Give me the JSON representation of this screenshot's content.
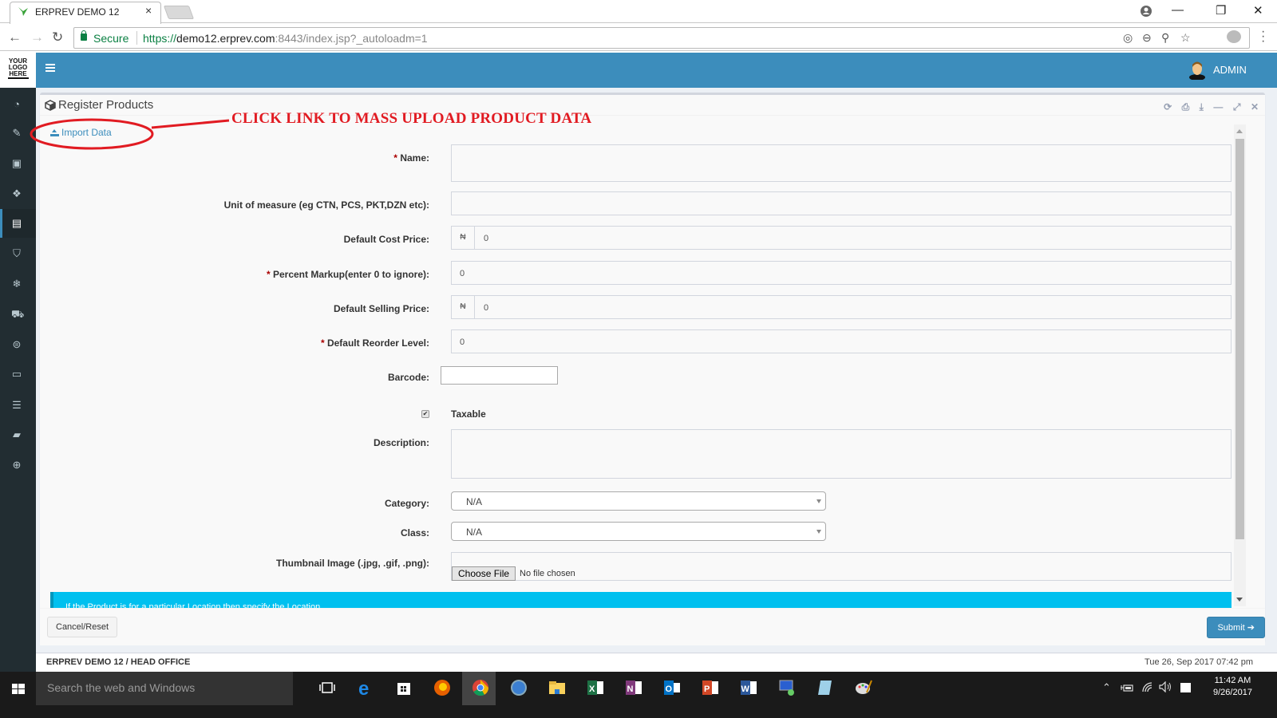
{
  "browser": {
    "tab_title": "ERPREV DEMO 12",
    "tab_close": "×",
    "secure_label": "Secure",
    "url_scheme": "https://",
    "url_host": "demo12.erprev.com",
    "url_rest": ":8443/index.jsp?_autoloadm=1",
    "window_controls": {
      "minimize": "—",
      "restore": "❐",
      "close": "✕"
    },
    "nav": {
      "back": "←",
      "forward": "→",
      "reload": "↻"
    },
    "omni_icons": {
      "location": "◎",
      "zoom": "⊖",
      "key": "⚲",
      "bookmark": "☆"
    }
  },
  "app": {
    "logo_lines": [
      "YOUR",
      "LOGO",
      "HERE"
    ],
    "user_label": "ADMIN",
    "sidebar_icons": [
      "dashboard-icon",
      "ticket-icon",
      "money-icon",
      "cubes-icon",
      "building-icon",
      "trash-icon",
      "snowflake-icon",
      "cart-icon",
      "circle-icon",
      "desktop-icon",
      "database-icon",
      "book-icon",
      "lifebuoy-icon"
    ],
    "sidebar_active_index": 4
  },
  "page": {
    "title": "Register Products",
    "import_link": "Import Data",
    "box_tools": {
      "refresh": "⟳",
      "print": "⎙",
      "download": "⤓",
      "minimize": "—",
      "expand": "⤢",
      "close": "✕"
    },
    "annotation": "CLICK LINK TO MASS UPLOAD PRODUCT DATA",
    "form": {
      "name_label": "Name:",
      "name_value": "",
      "uom_label": "Unit of measure (eg CTN, PCS, PKT,DZN etc):",
      "uom_value": "",
      "cost_label": "Default Cost Price:",
      "cost_currency": "₦",
      "cost_value": "0",
      "markup_label": "Percent Markup(enter 0 to ignore):",
      "markup_value": "0",
      "selling_label": "Default Selling Price:",
      "selling_currency": "₦",
      "selling_value": "0",
      "reorder_label": "Default Reorder Level:",
      "reorder_value": "0",
      "barcode_label": "Barcode:",
      "barcode_value": "",
      "taxable_label": "Taxable",
      "taxable_checked": true,
      "description_label": "Description:",
      "description_value": "",
      "category_label": "Category:",
      "category_value": "N/A",
      "class_label": "Class:",
      "class_value": "N/A",
      "thumbnail_label": "Thumbnail Image (.jpg, .gif, .png):",
      "choose_file": "Choose File",
      "no_file": "No file chosen",
      "required_mark": "*",
      "location_callout": "If the Product is for a particular Location then specify the Location"
    },
    "buttons": {
      "cancel": "Cancel/Reset",
      "submit": "Submit"
    },
    "footer_left": "ERPREV DEMO 12 / HEAD OFFICE",
    "footer_right": "Tue 26, Sep 2017 07:42 pm"
  },
  "taskbar": {
    "search_placeholder": "Search the web and Windows",
    "apps": [
      "task-view",
      "edge",
      "store",
      "firefox",
      "chrome",
      "safari",
      "file-explorer",
      "excel",
      "onenote",
      "outlook",
      "powerpoint",
      "word",
      "remote-desktop",
      "notepad",
      "paint"
    ],
    "clock_time": "11:42 AM",
    "clock_date": "9/26/2017"
  }
}
